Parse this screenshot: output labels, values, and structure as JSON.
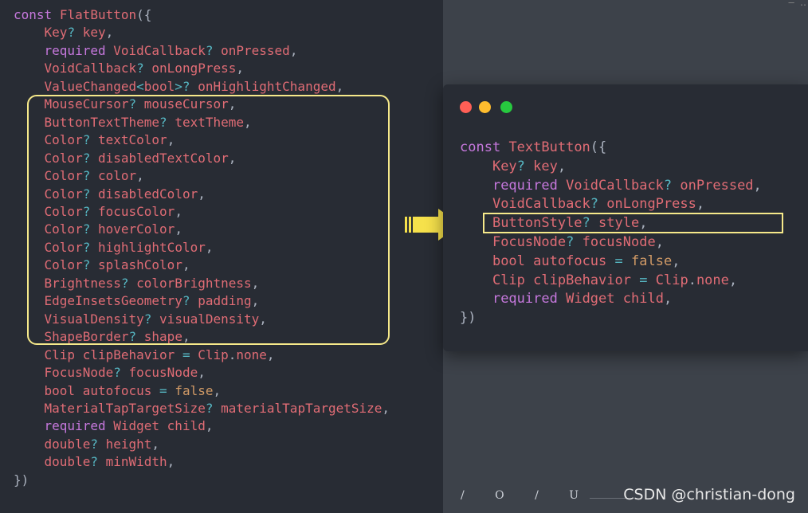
{
  "left_code": {
    "lines": [
      [
        [
          "k",
          "const"
        ],
        [
          "s",
          " "
        ],
        [
          "f",
          "FlatButton"
        ],
        [
          "p",
          "({"
        ]
      ],
      [
        [
          "s",
          "    "
        ],
        [
          "t",
          "Key"
        ],
        [
          "o",
          "?"
        ],
        [
          "s",
          " "
        ],
        [
          "i",
          "key"
        ],
        [
          "p",
          ","
        ]
      ],
      [
        [
          "s",
          "    "
        ],
        [
          "k",
          "required"
        ],
        [
          "s",
          " "
        ],
        [
          "t",
          "VoidCallback"
        ],
        [
          "o",
          "?"
        ],
        [
          "s",
          " "
        ],
        [
          "i",
          "onPressed"
        ],
        [
          "p",
          ","
        ]
      ],
      [
        [
          "s",
          "    "
        ],
        [
          "t",
          "VoidCallback"
        ],
        [
          "o",
          "?"
        ],
        [
          "s",
          " "
        ],
        [
          "i",
          "onLongPress"
        ],
        [
          "p",
          ","
        ]
      ],
      [
        [
          "s",
          "    "
        ],
        [
          "t",
          "ValueChanged"
        ],
        [
          "o",
          "<"
        ],
        [
          "t",
          "bool"
        ],
        [
          "o",
          ">?"
        ],
        [
          "s",
          " "
        ],
        [
          "i",
          "onHighlightChanged"
        ],
        [
          "p",
          ","
        ]
      ],
      [
        [
          "s",
          "    "
        ],
        [
          "t",
          "MouseCursor"
        ],
        [
          "o",
          "?"
        ],
        [
          "s",
          " "
        ],
        [
          "i",
          "mouseCursor"
        ],
        [
          "p",
          ","
        ]
      ],
      [
        [
          "s",
          "    "
        ],
        [
          "t",
          "ButtonTextTheme"
        ],
        [
          "o",
          "?"
        ],
        [
          "s",
          " "
        ],
        [
          "i",
          "textTheme"
        ],
        [
          "p",
          ","
        ]
      ],
      [
        [
          "s",
          "    "
        ],
        [
          "t",
          "Color"
        ],
        [
          "o",
          "?"
        ],
        [
          "s",
          " "
        ],
        [
          "i",
          "textColor"
        ],
        [
          "p",
          ","
        ]
      ],
      [
        [
          "s",
          "    "
        ],
        [
          "t",
          "Color"
        ],
        [
          "o",
          "?"
        ],
        [
          "s",
          " "
        ],
        [
          "i",
          "disabledTextColor"
        ],
        [
          "p",
          ","
        ]
      ],
      [
        [
          "s",
          "    "
        ],
        [
          "t",
          "Color"
        ],
        [
          "o",
          "?"
        ],
        [
          "s",
          " "
        ],
        [
          "i",
          "color"
        ],
        [
          "p",
          ","
        ]
      ],
      [
        [
          "s",
          "    "
        ],
        [
          "t",
          "Color"
        ],
        [
          "o",
          "?"
        ],
        [
          "s",
          " "
        ],
        [
          "i",
          "disabledColor"
        ],
        [
          "p",
          ","
        ]
      ],
      [
        [
          "s",
          "    "
        ],
        [
          "t",
          "Color"
        ],
        [
          "o",
          "?"
        ],
        [
          "s",
          " "
        ],
        [
          "i",
          "focusColor"
        ],
        [
          "p",
          ","
        ]
      ],
      [
        [
          "s",
          "    "
        ],
        [
          "t",
          "Color"
        ],
        [
          "o",
          "?"
        ],
        [
          "s",
          " "
        ],
        [
          "i",
          "hoverColor"
        ],
        [
          "p",
          ","
        ]
      ],
      [
        [
          "s",
          "    "
        ],
        [
          "t",
          "Color"
        ],
        [
          "o",
          "?"
        ],
        [
          "s",
          " "
        ],
        [
          "i",
          "highlightColor"
        ],
        [
          "p",
          ","
        ]
      ],
      [
        [
          "s",
          "    "
        ],
        [
          "t",
          "Color"
        ],
        [
          "o",
          "?"
        ],
        [
          "s",
          " "
        ],
        [
          "i",
          "splashColor"
        ],
        [
          "p",
          ","
        ]
      ],
      [
        [
          "s",
          "    "
        ],
        [
          "t",
          "Brightness"
        ],
        [
          "o",
          "?"
        ],
        [
          "s",
          " "
        ],
        [
          "i",
          "colorBrightness"
        ],
        [
          "p",
          ","
        ]
      ],
      [
        [
          "s",
          "    "
        ],
        [
          "t",
          "EdgeInsetsGeometry"
        ],
        [
          "o",
          "?"
        ],
        [
          "s",
          " "
        ],
        [
          "i",
          "padding"
        ],
        [
          "p",
          ","
        ]
      ],
      [
        [
          "s",
          "    "
        ],
        [
          "t",
          "VisualDensity"
        ],
        [
          "o",
          "?"
        ],
        [
          "s",
          " "
        ],
        [
          "i",
          "visualDensity"
        ],
        [
          "p",
          ","
        ]
      ],
      [
        [
          "s",
          "    "
        ],
        [
          "t",
          "ShapeBorder"
        ],
        [
          "o",
          "?"
        ],
        [
          "s",
          " "
        ],
        [
          "i",
          "shape"
        ],
        [
          "p",
          ","
        ]
      ],
      [
        [
          "s",
          "    "
        ],
        [
          "t",
          "Clip"
        ],
        [
          "s",
          " "
        ],
        [
          "i",
          "clipBehavior"
        ],
        [
          "s",
          " "
        ],
        [
          "o",
          "="
        ],
        [
          "s",
          " "
        ],
        [
          "t",
          "Clip"
        ],
        [
          "p",
          "."
        ],
        [
          "i",
          "none"
        ],
        [
          "p",
          ","
        ]
      ],
      [
        [
          "s",
          "    "
        ],
        [
          "t",
          "FocusNode"
        ],
        [
          "o",
          "?"
        ],
        [
          "s",
          " "
        ],
        [
          "i",
          "focusNode"
        ],
        [
          "p",
          ","
        ]
      ],
      [
        [
          "s",
          "    "
        ],
        [
          "t",
          "bool"
        ],
        [
          "s",
          " "
        ],
        [
          "i",
          "autofocus"
        ],
        [
          "s",
          " "
        ],
        [
          "o",
          "="
        ],
        [
          "s",
          " "
        ],
        [
          "b",
          "false"
        ],
        [
          "p",
          ","
        ]
      ],
      [
        [
          "s",
          "    "
        ],
        [
          "t",
          "MaterialTapTargetSize"
        ],
        [
          "o",
          "?"
        ],
        [
          "s",
          " "
        ],
        [
          "i",
          "materialTapTargetSize"
        ],
        [
          "p",
          ","
        ]
      ],
      [
        [
          "s",
          "    "
        ],
        [
          "k",
          "required"
        ],
        [
          "s",
          " "
        ],
        [
          "t",
          "Widget"
        ],
        [
          "s",
          " "
        ],
        [
          "i",
          "child"
        ],
        [
          "p",
          ","
        ]
      ],
      [
        [
          "s",
          "    "
        ],
        [
          "t",
          "double"
        ],
        [
          "o",
          "?"
        ],
        [
          "s",
          " "
        ],
        [
          "i",
          "height"
        ],
        [
          "p",
          ","
        ]
      ],
      [
        [
          "s",
          "    "
        ],
        [
          "t",
          "double"
        ],
        [
          "o",
          "?"
        ],
        [
          "s",
          " "
        ],
        [
          "i",
          "minWidth"
        ],
        [
          "p",
          ","
        ]
      ],
      [
        [
          "p",
          "})"
        ]
      ]
    ]
  },
  "right_code": {
    "lines": [
      [
        [
          "k",
          "const"
        ],
        [
          "s",
          " "
        ],
        [
          "f",
          "TextButton"
        ],
        [
          "p",
          "({"
        ]
      ],
      [
        [
          "s",
          "    "
        ],
        [
          "t",
          "Key"
        ],
        [
          "o",
          "?"
        ],
        [
          "s",
          " "
        ],
        [
          "i",
          "key"
        ],
        [
          "p",
          ","
        ]
      ],
      [
        [
          "s",
          "    "
        ],
        [
          "k",
          "required"
        ],
        [
          "s",
          " "
        ],
        [
          "t",
          "VoidCallback"
        ],
        [
          "o",
          "?"
        ],
        [
          "s",
          " "
        ],
        [
          "i",
          "onPressed"
        ],
        [
          "p",
          ","
        ]
      ],
      [
        [
          "s",
          "    "
        ],
        [
          "t",
          "VoidCallback"
        ],
        [
          "o",
          "?"
        ],
        [
          "s",
          " "
        ],
        [
          "i",
          "onLongPress"
        ],
        [
          "p",
          ","
        ]
      ],
      [
        [
          "s",
          "    "
        ],
        [
          "t",
          "ButtonStyle"
        ],
        [
          "o",
          "?"
        ],
        [
          "s",
          " "
        ],
        [
          "i",
          "style"
        ],
        [
          "p",
          ","
        ]
      ],
      [
        [
          "s",
          "    "
        ],
        [
          "t",
          "FocusNode"
        ],
        [
          "o",
          "?"
        ],
        [
          "s",
          " "
        ],
        [
          "i",
          "focusNode"
        ],
        [
          "p",
          ","
        ]
      ],
      [
        [
          "s",
          "    "
        ],
        [
          "t",
          "bool"
        ],
        [
          "s",
          " "
        ],
        [
          "i",
          "autofocus"
        ],
        [
          "s",
          " "
        ],
        [
          "o",
          "="
        ],
        [
          "s",
          " "
        ],
        [
          "b",
          "false"
        ],
        [
          "p",
          ","
        ]
      ],
      [
        [
          "s",
          "    "
        ],
        [
          "t",
          "Clip"
        ],
        [
          "s",
          " "
        ],
        [
          "i",
          "clipBehavior"
        ],
        [
          "s",
          " "
        ],
        [
          "o",
          "="
        ],
        [
          "s",
          " "
        ],
        [
          "t",
          "Clip"
        ],
        [
          "p",
          "."
        ],
        [
          "i",
          "none"
        ],
        [
          "p",
          ","
        ]
      ],
      [
        [
          "s",
          "    "
        ],
        [
          "k",
          "required"
        ],
        [
          "s",
          " "
        ],
        [
          "t",
          "Widget"
        ],
        [
          "s",
          " "
        ],
        [
          "i",
          "child"
        ],
        [
          "p",
          ","
        ]
      ],
      [
        [
          "p",
          "})"
        ]
      ]
    ]
  },
  "window_controls": {
    "close_color": "#ff5f56",
    "minimize_color": "#ffbd2e",
    "maximize_color": "#27c93f"
  },
  "highlight_color": "#f6e98a",
  "arrow_color": "#f6e14b",
  "footer": {
    "marks": [
      "/",
      "O",
      "/",
      "U"
    ],
    "watermark": "CSDN @christian-dong",
    "corner": "—  ‥"
  }
}
